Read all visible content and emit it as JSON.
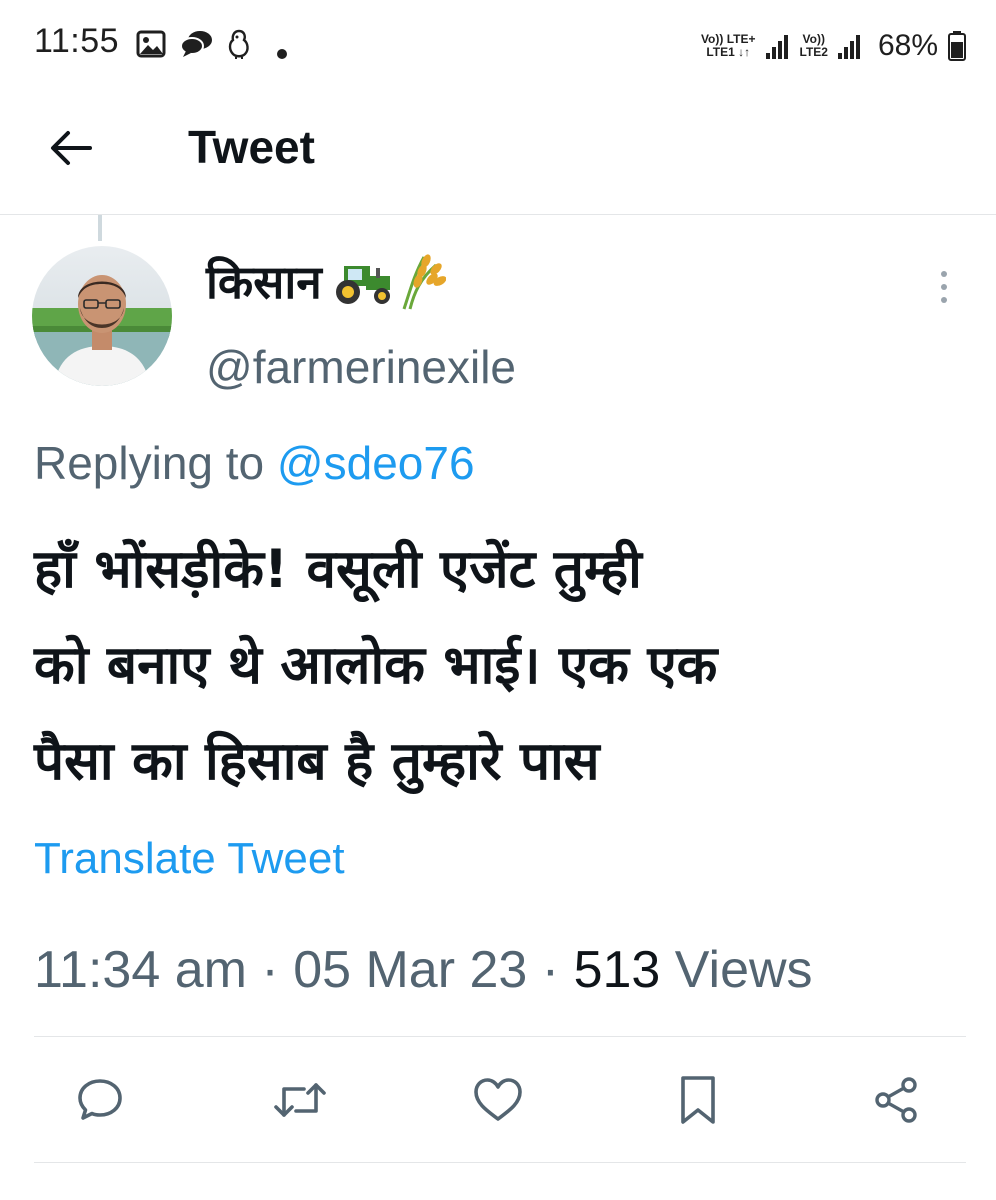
{
  "status_bar": {
    "time": "11:55",
    "notification_icons": [
      "gallery-icon",
      "chat-bubble-icon",
      "bird-icon",
      "dot-icon"
    ],
    "sim1": {
      "top": "Vo)) LTE+",
      "bottom": "LTE1 ↓↑"
    },
    "sim2": {
      "top": "Vo))",
      "bottom": "LTE2"
    },
    "battery": "68%"
  },
  "header": {
    "title": "Tweet",
    "back_icon": "arrow-left-icon"
  },
  "tweet": {
    "display_name": "किसान",
    "name_emojis": [
      "tractor-emoji",
      "rice-sheaf-emoji"
    ],
    "handle": "@farmerinexile",
    "replying_prefix": "Replying to",
    "replying_handle": "@sdeo76",
    "text_lines": [
      "हाँ भोंसड़ीके! वसूली एजेंट तुम्ही",
      "को बनाए थे आलोक भाई। एक एक",
      "पैसा का हिसाब है तुम्हारे पास"
    ],
    "translate_label": "Translate Tweet",
    "time": "11:34 am",
    "date": "05 Mar 23",
    "separator": "·",
    "views_count": "513",
    "views_label": "Views"
  },
  "actions": [
    "reply-icon",
    "retweet-icon",
    "like-icon",
    "bookmark-icon",
    "share-icon"
  ],
  "colors": {
    "accent": "#1d9bf0",
    "text_primary": "#0f1419",
    "text_secondary": "#536471",
    "divider": "#e4e6e8"
  }
}
